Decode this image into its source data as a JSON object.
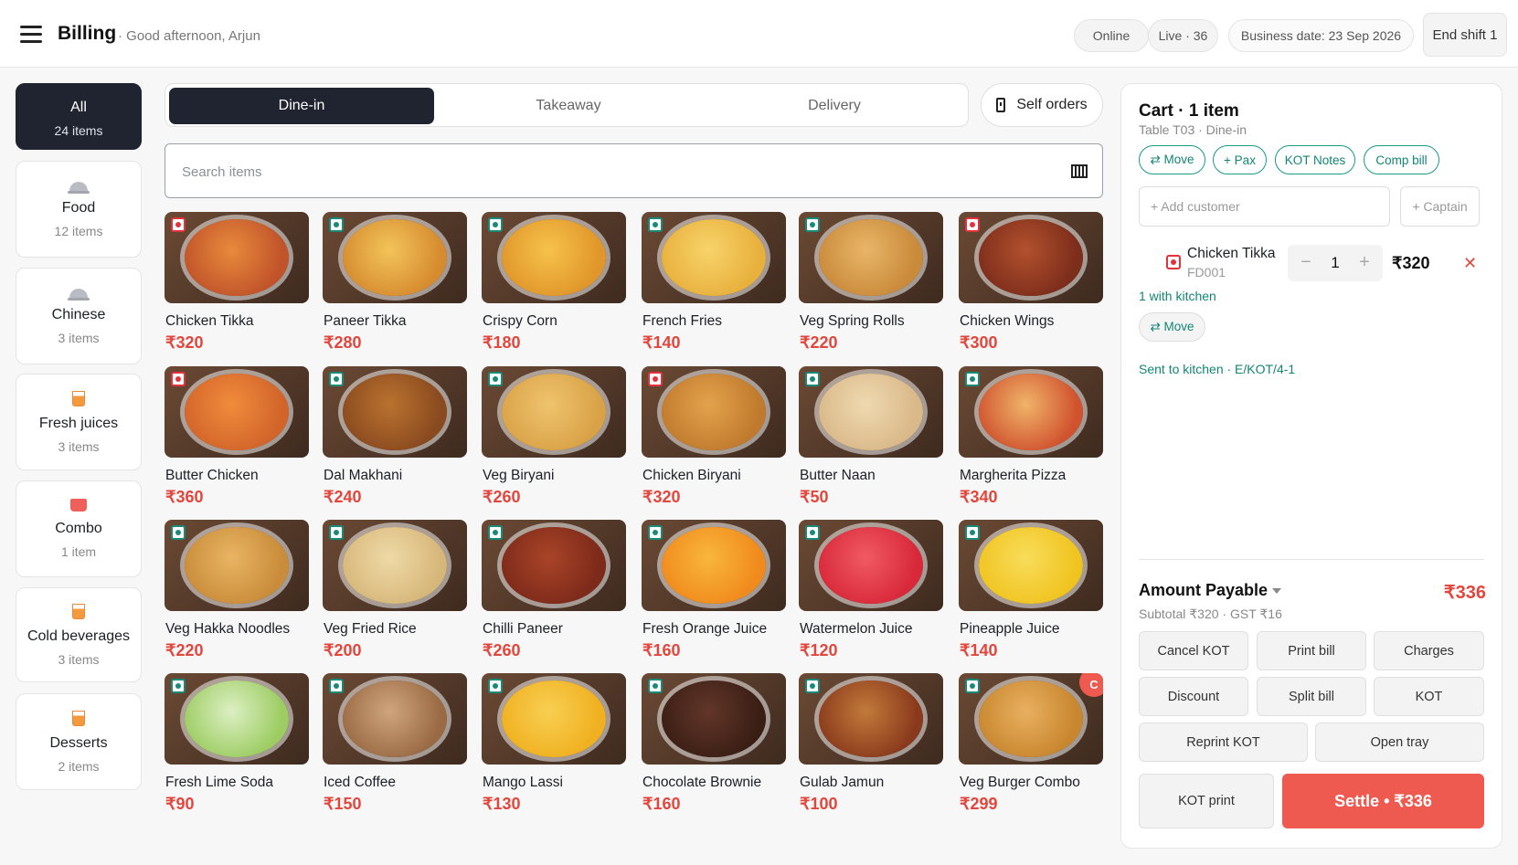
{
  "header": {
    "title": "Billing",
    "greeting": "· Good afternoon, Arjun",
    "status_online": "Online",
    "status_live": "Live · 36",
    "business_date": "Business date: 23 Sep 2026",
    "end_shift": "End shift 1"
  },
  "categories": [
    {
      "name": "All",
      "count": "24 items",
      "active": true
    },
    {
      "name": "Food",
      "count": "12 items",
      "icon": "cloche-icon"
    },
    {
      "name": "Chinese",
      "count": "3 items",
      "icon": "cloche-icon"
    },
    {
      "name": "Fresh juices",
      "count": "3 items",
      "icon": "juice-cup-icon"
    },
    {
      "name": "Combo",
      "count": "1 item",
      "icon": "combo-cup-icon"
    },
    {
      "name": "Cold beverages",
      "count": "3 items",
      "icon": "juice-cup-icon"
    },
    {
      "name": "Desserts",
      "count": "2 items",
      "icon": "juice-cup-icon"
    }
  ],
  "order_types": {
    "tabs": [
      "Dine-in",
      "Takeaway",
      "Delivery"
    ],
    "active": "Dine-in",
    "self_orders": "Self orders"
  },
  "search": {
    "placeholder": "Search items",
    "value": ""
  },
  "items": [
    {
      "name": "Chicken Tikka",
      "price": "₹320",
      "diet": "non-veg",
      "colors": [
        "#c0532a",
        "#e88a3c"
      ]
    },
    {
      "name": "Paneer Tikka",
      "price": "₹280",
      "diet": "veg",
      "colors": [
        "#d68b2f",
        "#f2c45a"
      ]
    },
    {
      "name": "Crispy Corn",
      "price": "₹180",
      "diet": "veg",
      "colors": [
        "#e0962a",
        "#f6c24a"
      ]
    },
    {
      "name": "French Fries",
      "price": "₹140",
      "diet": "veg",
      "colors": [
        "#e8b03c",
        "#f7d36a"
      ]
    },
    {
      "name": "Veg Spring Rolls",
      "price": "₹220",
      "diet": "veg",
      "colors": [
        "#c98a3a",
        "#e9b568"
      ]
    },
    {
      "name": "Chicken Wings",
      "price": "₹300",
      "diet": "non-veg",
      "colors": [
        "#7d2d1c",
        "#b2512d"
      ]
    },
    {
      "name": "Butter Chicken",
      "price": "₹360",
      "diet": "non-veg",
      "colors": [
        "#d2642a",
        "#f08c3c"
      ]
    },
    {
      "name": "Dal Makhani",
      "price": "₹240",
      "diet": "veg",
      "colors": [
        "#8a4a1f",
        "#b9722f"
      ]
    },
    {
      "name": "Veg Biryani",
      "price": "₹260",
      "diet": "veg",
      "colors": [
        "#d9a247",
        "#efc36d"
      ]
    },
    {
      "name": "Chicken Biryani",
      "price": "₹320",
      "diet": "non-veg",
      "colors": [
        "#c07a2d",
        "#e3a24c"
      ]
    },
    {
      "name": "Butter Naan",
      "price": "₹50",
      "diet": "veg",
      "colors": [
        "#d9b889",
        "#efd9b0"
      ]
    },
    {
      "name": "Margherita Pizza",
      "price": "₹340",
      "diet": "veg",
      "colors": [
        "#d0522e",
        "#f0b46a"
      ]
    },
    {
      "name": "Veg Hakka Noodles",
      "price": "₹220",
      "diet": "veg",
      "colors": [
        "#c98c3a",
        "#e8b463"
      ]
    },
    {
      "name": "Veg Fried Rice",
      "price": "₹200",
      "diet": "veg",
      "colors": [
        "#d6b77a",
        "#efd9a6"
      ]
    },
    {
      "name": "Chilli Paneer",
      "price": "₹260",
      "diet": "veg",
      "colors": [
        "#7d2a1a",
        "#a94428"
      ]
    },
    {
      "name": "Fresh Orange Juice",
      "price": "₹160",
      "diet": "veg",
      "colors": [
        "#f08a1c",
        "#f8b73c"
      ]
    },
    {
      "name": "Watermelon Juice",
      "price": "₹120",
      "diet": "veg",
      "colors": [
        "#d8283a",
        "#f05a62"
      ]
    },
    {
      "name": "Pineapple Juice",
      "price": "₹140",
      "diet": "veg",
      "colors": [
        "#f0c420",
        "#f8dc5a"
      ]
    },
    {
      "name": "Fresh Lime Soda",
      "price": "₹90",
      "diet": "veg",
      "colors": [
        "#9ccc62",
        "#dcefc3"
      ]
    },
    {
      "name": "Iced Coffee",
      "price": "₹150",
      "diet": "veg",
      "colors": [
        "#9a6a44",
        "#cfa57c"
      ]
    },
    {
      "name": "Mango Lassi",
      "price": "₹130",
      "diet": "veg",
      "colors": [
        "#f0b020",
        "#f8cf52"
      ]
    },
    {
      "name": "Chocolate Brownie",
      "price": "₹160",
      "diet": "veg",
      "colors": [
        "#3a1e14",
        "#63362a"
      ]
    },
    {
      "name": "Gulab Jamun",
      "price": "₹100",
      "diet": "veg",
      "colors": [
        "#8a3a1c",
        "#c27a3a"
      ]
    },
    {
      "name": "Veg Burger Combo",
      "price": "₹299",
      "diet": "veg",
      "colors": [
        "#c8862e",
        "#e9b060"
      ],
      "badge": "C"
    }
  ],
  "cart": {
    "title": "Cart · 1 item",
    "subtitle": "Table T03 · Dine-in",
    "actions": [
      "⇄ Move",
      "+ Pax",
      "KOT Notes",
      "Comp bill"
    ],
    "add_customer": "+ Add customer",
    "captain": "+ Captain",
    "line": {
      "name": "Chicken Tikka",
      "code": "FD001",
      "qty": "1",
      "price": "₹320",
      "diet": "non-veg",
      "decrement": "−",
      "increment": "+",
      "remove": "✕"
    },
    "kitchen_status": "1 with kitchen",
    "move_chip": "⇄ Move",
    "sent_status": "Sent to kitchen · E/KOT/4-1",
    "amount_payable_label": "Amount Payable",
    "amount_payable": "₹336",
    "subtotal_line": "Subtotal ₹320 · GST ₹16",
    "buttons": {
      "cancel_kot": "Cancel KOT",
      "print_bill": "Print bill",
      "charges": "Charges",
      "discount": "Discount",
      "split_bill": "Split bill",
      "kot": "KOT",
      "reprint_kot": "Reprint KOT",
      "open_tray": "Open tray",
      "kot_print": "KOT print",
      "settle": "Settle • ₹336"
    }
  }
}
